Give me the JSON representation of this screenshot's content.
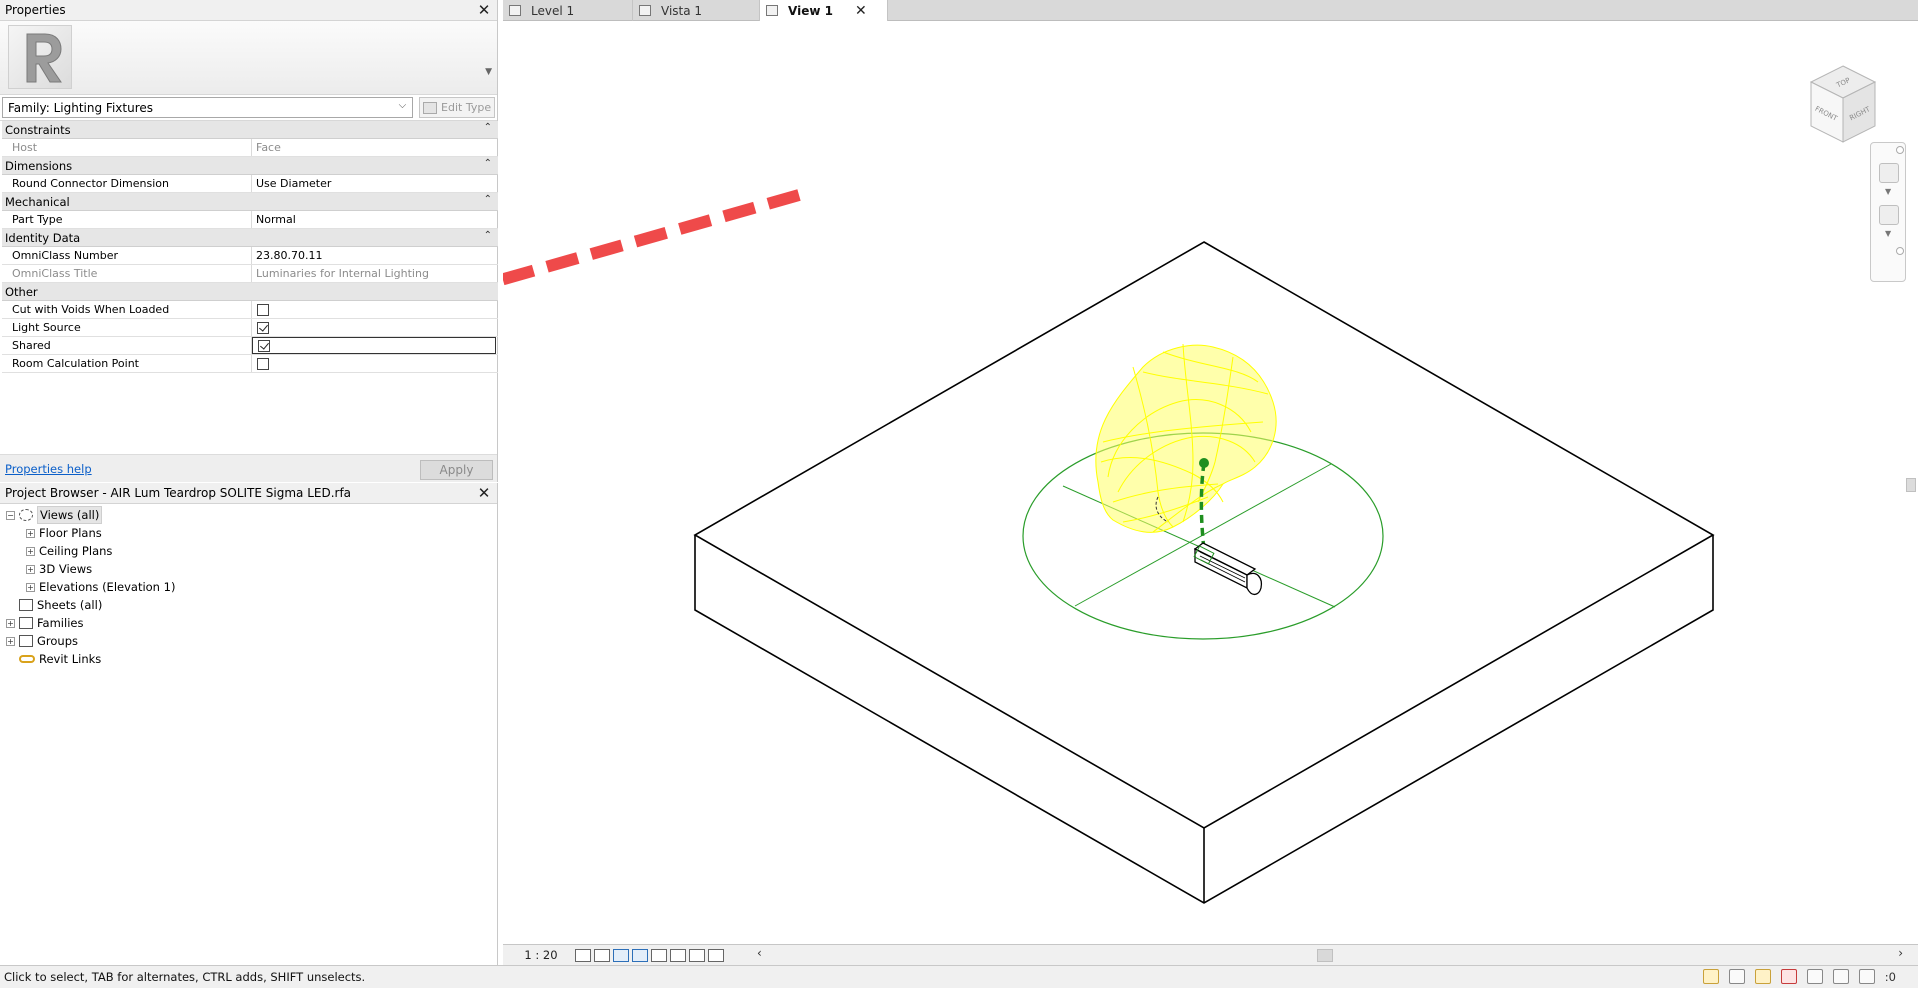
{
  "properties": {
    "title": "Properties",
    "type_selector": "Family: Lighting Fixtures",
    "edit_type_label": "Edit Type",
    "groups": [
      {
        "name": "Constraints",
        "rows": [
          {
            "key": "Host",
            "value": "Face",
            "readonly": true
          }
        ]
      },
      {
        "name": "Dimensions",
        "rows": [
          {
            "key": "Round Connector Dimension",
            "value": "Use Diameter",
            "readonly": false
          }
        ]
      },
      {
        "name": "Mechanical",
        "rows": [
          {
            "key": "Part Type",
            "value": "Normal",
            "readonly": false
          }
        ]
      },
      {
        "name": "Identity Data",
        "rows": [
          {
            "key": "OmniClass Number",
            "value": "23.80.70.11",
            "readonly": false
          },
          {
            "key": "OmniClass Title",
            "value": "Luminaries for Internal Lighting",
            "readonly": true
          }
        ]
      },
      {
        "name": "Other",
        "rows": [
          {
            "key": "Cut with Voids When Loaded",
            "checked": false
          },
          {
            "key": "Light Source",
            "checked": true
          },
          {
            "key": "Shared",
            "checked": true
          },
          {
            "key": "Room Calculation Point",
            "checked": false
          }
        ]
      }
    ],
    "help_link": "Properties help",
    "apply_label": "Apply"
  },
  "project_browser": {
    "title": "Project Browser - AIR Lum Teardrop SOLITE Sigma LED.rfa",
    "tree": [
      {
        "label": "Views (all)",
        "level": 0,
        "toggle": "⊟",
        "icon": "views-icon"
      },
      {
        "label": "Floor Plans",
        "level": 1,
        "toggle": "⊞",
        "icon": ""
      },
      {
        "label": "Ceiling Plans",
        "level": 1,
        "toggle": "⊞",
        "icon": ""
      },
      {
        "label": "3D Views",
        "level": 1,
        "toggle": "⊞",
        "icon": ""
      },
      {
        "label": "Elevations (Elevation 1)",
        "level": 1,
        "toggle": "⊞",
        "icon": ""
      },
      {
        "label": "Sheets (all)",
        "level": 0,
        "toggle": "",
        "icon": "sheets-icon"
      },
      {
        "label": "Families",
        "level": 0,
        "toggle": "⊞",
        "icon": "families-icon"
      },
      {
        "label": "Groups",
        "level": 0,
        "toggle": "⊞",
        "icon": "groups-icon"
      },
      {
        "label": "Revit Links",
        "level": 0,
        "toggle": "",
        "icon": "revit-links-icon"
      }
    ]
  },
  "tabs": [
    {
      "label": "Level 1",
      "icon": "floor-plan-icon",
      "active": false
    },
    {
      "label": "Vista 1",
      "icon": "3d-view-icon",
      "active": false
    },
    {
      "label": "View 1",
      "icon": "3d-view-icon",
      "active": true
    }
  ],
  "viewcube": {
    "top": "TOP",
    "front": "FRONT",
    "right": "RIGHT"
  },
  "view_controls": {
    "scale": "1 : 20"
  },
  "status": {
    "message": "Click to select, TAB for alternates, CTRL adds, SHIFT unselects.",
    "filter_count": ":0"
  },
  "colors": {
    "annotation_red": "#ef4a4a",
    "light_yellow": "#ffff00",
    "connector_green": "#2a9d2a"
  }
}
